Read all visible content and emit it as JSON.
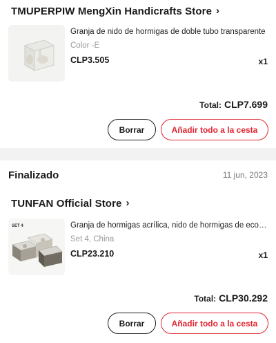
{
  "orders": [
    {
      "store": "TMUPERPIW MengXin Handicrafts Store",
      "item": {
        "title": "Granja de nido de hormigas de doble tubo transparente",
        "variant": "Color -E",
        "price": "CLP3.505",
        "qty": "x1",
        "image_icon": "ant-farm-product-image"
      },
      "total_label": "Total:",
      "total_value": "CLP7.699",
      "btn_remove": "Borrar",
      "btn_add_all": "Añadir todo a la cesta"
    },
    {
      "status": "Finalizado",
      "date": "11 jun, 2023",
      "store": "TUNFAN Official Store",
      "item": {
        "title": "Granja de hormigas acrílica, nido de hormigas de ecología",
        "variant": "Set 4, China",
        "price": "CLP23.210",
        "qty": "x1",
        "image_tag": "SET 4",
        "image_icon": "acrylic-ant-nest-image"
      },
      "total_label": "Total:",
      "total_value": "CLP30.292",
      "btn_remove": "Borrar",
      "btn_add_all": "Añadir todo a la cesta"
    }
  ],
  "colors": {
    "accent": "#e0242f",
    "text": "#1a1a1a",
    "muted": "#999999",
    "background": "#f2f2f2"
  }
}
